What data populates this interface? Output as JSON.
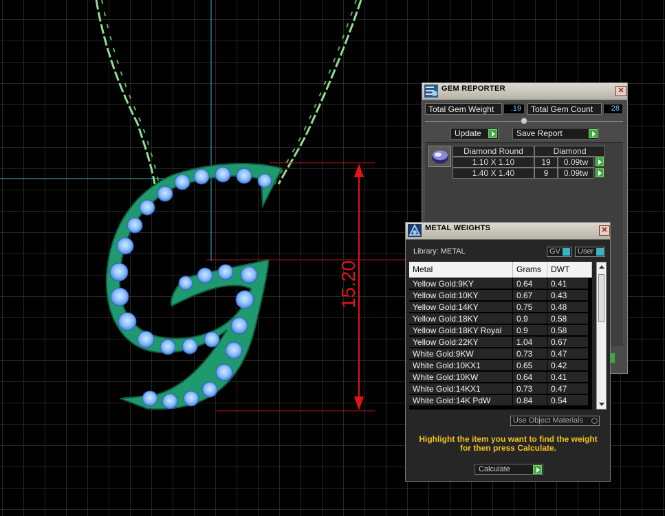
{
  "viewport": {
    "dimension_value": "15.20"
  },
  "gem_reporter": {
    "title": "GEM REPORTER",
    "close_symbol": "✕",
    "total_gem_weight_label": "Total Gem Weight",
    "total_gem_weight_value": ".19",
    "total_gem_count_label": "Total Gem Count",
    "total_gem_count_value": "28",
    "update_label": "Update",
    "save_report_label": "Save Report",
    "header_shape": "Diamond Round",
    "header_material": "Diamond",
    "rows": [
      {
        "size": "1.10 X 1.10",
        "count": "19",
        "weight": "0.09tw"
      },
      {
        "size": "1.40 X 1.40",
        "count": "9",
        "weight": "0.09tw"
      }
    ]
  },
  "metal_weights": {
    "title": "METAL WEIGHTS",
    "close_symbol": "✕",
    "library_label": "Library: METAL",
    "gv_label": "GV",
    "user_label": "User",
    "columns": [
      "Metal",
      "Grams",
      "DWT"
    ],
    "rows": [
      {
        "metal": "Yellow Gold:9KY",
        "grams": "0.64",
        "dwt": "0.41"
      },
      {
        "metal": "Yellow Gold:10KY",
        "grams": "0.67",
        "dwt": "0.43"
      },
      {
        "metal": "Yellow Gold:14KY",
        "grams": "0.75",
        "dwt": "0.48"
      },
      {
        "metal": "Yellow Gold:18KY",
        "grams": "0.9",
        "dwt": "0.58"
      },
      {
        "metal": "Yellow Gold:18KY Royal",
        "grams": "0.9",
        "dwt": "0.58"
      },
      {
        "metal": "Yellow Gold:22KY",
        "grams": "1.04",
        "dwt": "0.67"
      },
      {
        "metal": "White Gold:9KW",
        "grams": "0.73",
        "dwt": "0.47"
      },
      {
        "metal": "White Gold:10KX1",
        "grams": "0.65",
        "dwt": "0.42"
      },
      {
        "metal": "White Gold:10KW",
        "grams": "0.64",
        "dwt": "0.41"
      },
      {
        "metal": "White Gold:14KX1",
        "grams": "0.73",
        "dwt": "0.47"
      },
      {
        "metal": "White Gold:14K PdW",
        "grams": "0.84",
        "dwt": "0.54"
      }
    ],
    "use_object_materials_label": "Use Object Materials",
    "instruction_text": "Highlight the item you want to find the weight for then press Calculate.",
    "calculate_label": "Calculate"
  },
  "colors": {
    "accent_green": "#3aaa3a",
    "instruction_yellow": "#f2c21b",
    "value_cyan": "#6fd0ff",
    "dimension_red": "#e0141b",
    "jewelry_green": "#1f9a6e",
    "gem_blue": "#8fc7ff"
  }
}
